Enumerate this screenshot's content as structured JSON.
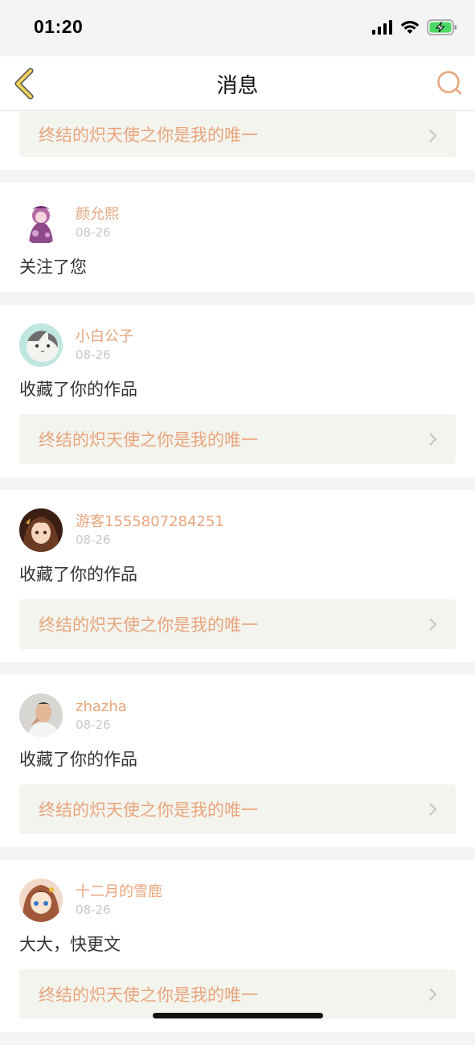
{
  "status_bar": {
    "time": "01:20",
    "icons": [
      "signal-icon",
      "wifi-icon",
      "battery-charging-icon"
    ]
  },
  "nav": {
    "title": "消息",
    "back_icon": "chevron-left-icon",
    "search_icon": "search-icon"
  },
  "colors": {
    "accent": "#e8a57c",
    "back_icon": "#e8c23a",
    "work_box_bg": "#f4f4ee",
    "page_bg": "#f4f3f6"
  },
  "first_card": {
    "work_title": "终结的炽天使之你是我的唯一"
  },
  "messages": [
    {
      "username": "颜允熙",
      "date": "08-26",
      "action": "关注了您"
    },
    {
      "username": "小白公子",
      "date": "08-26",
      "action": "收藏了你的作品",
      "work_title": "终结的炽天使之你是我的唯一"
    },
    {
      "username": "游客1555807284251",
      "date": "08-26",
      "action": "收藏了你的作品",
      "work_title": "终结的炽天使之你是我的唯一"
    },
    {
      "username": "zhazha",
      "date": "08-26",
      "action": "收藏了你的作品",
      "work_title": "终结的炽天使之你是我的唯一"
    },
    {
      "username": "十二月的雪鹿",
      "date": "08-26",
      "action": "大大，快更文",
      "work_title": "终结的炽天使之你是我的唯一"
    }
  ]
}
